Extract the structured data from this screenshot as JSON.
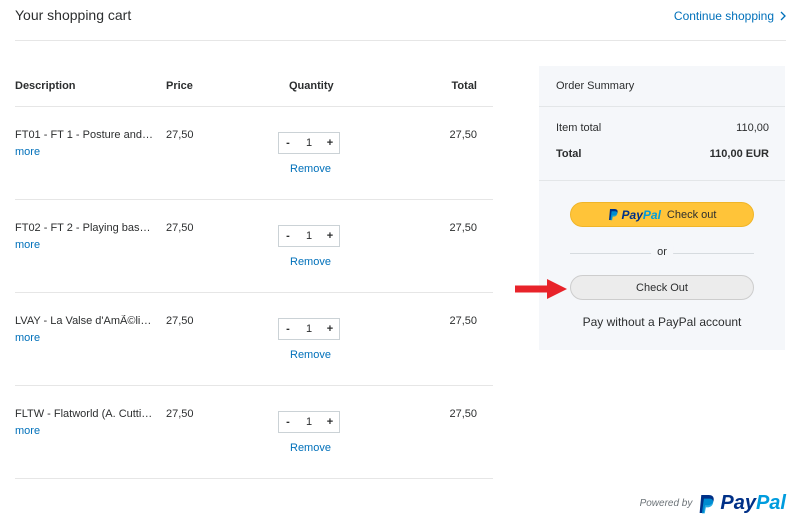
{
  "header": {
    "title": "Your shopping cart",
    "continue_label": "Continue shopping"
  },
  "cart": {
    "columns": {
      "description": "Description",
      "price": "Price",
      "quantity": "Quantity",
      "total": "Total"
    },
    "items": [
      {
        "description": "FT01 - FT 1 - Posture and…",
        "more": "more",
        "price": "27,50",
        "quantity": "1",
        "remove": "Remove",
        "total": "27,50"
      },
      {
        "description": "FT02 - FT 2 - Playing bas…",
        "more": "more",
        "price": "27,50",
        "quantity": "1",
        "remove": "Remove",
        "total": "27,50"
      },
      {
        "description": "LVAY - La Valse d'AmÃ©li…",
        "more": "more",
        "price": "27,50",
        "quantity": "1",
        "remove": "Remove",
        "total": "27,50"
      },
      {
        "description": "FLTW - Flatworld (A. Cutti…",
        "more": "more",
        "price": "27,50",
        "quantity": "1",
        "remove": "Remove",
        "total": "27,50"
      }
    ],
    "minus": "-",
    "plus": "+"
  },
  "summary": {
    "title": "Order Summary",
    "item_total_label": "Item total",
    "item_total_value": "110,00",
    "total_label": "Total",
    "total_value": "110,00 EUR",
    "paypal_button": {
      "brand_pay": "Pay",
      "brand_pal": "Pal",
      "label": "Check out"
    },
    "or_label": "or",
    "checkout_label": "Check Out",
    "pay_without_label": "Pay without a PayPal account"
  },
  "footer": {
    "powered_by": "Powered by",
    "brand_pay": "Pay",
    "brand_pal": "Pal"
  },
  "colors": {
    "link": "#0070ba",
    "paypal_yellow": "#ffc439",
    "paypal_dark_blue": "#003087",
    "paypal_light_blue": "#009cde",
    "arrow_red": "#e8232a"
  }
}
